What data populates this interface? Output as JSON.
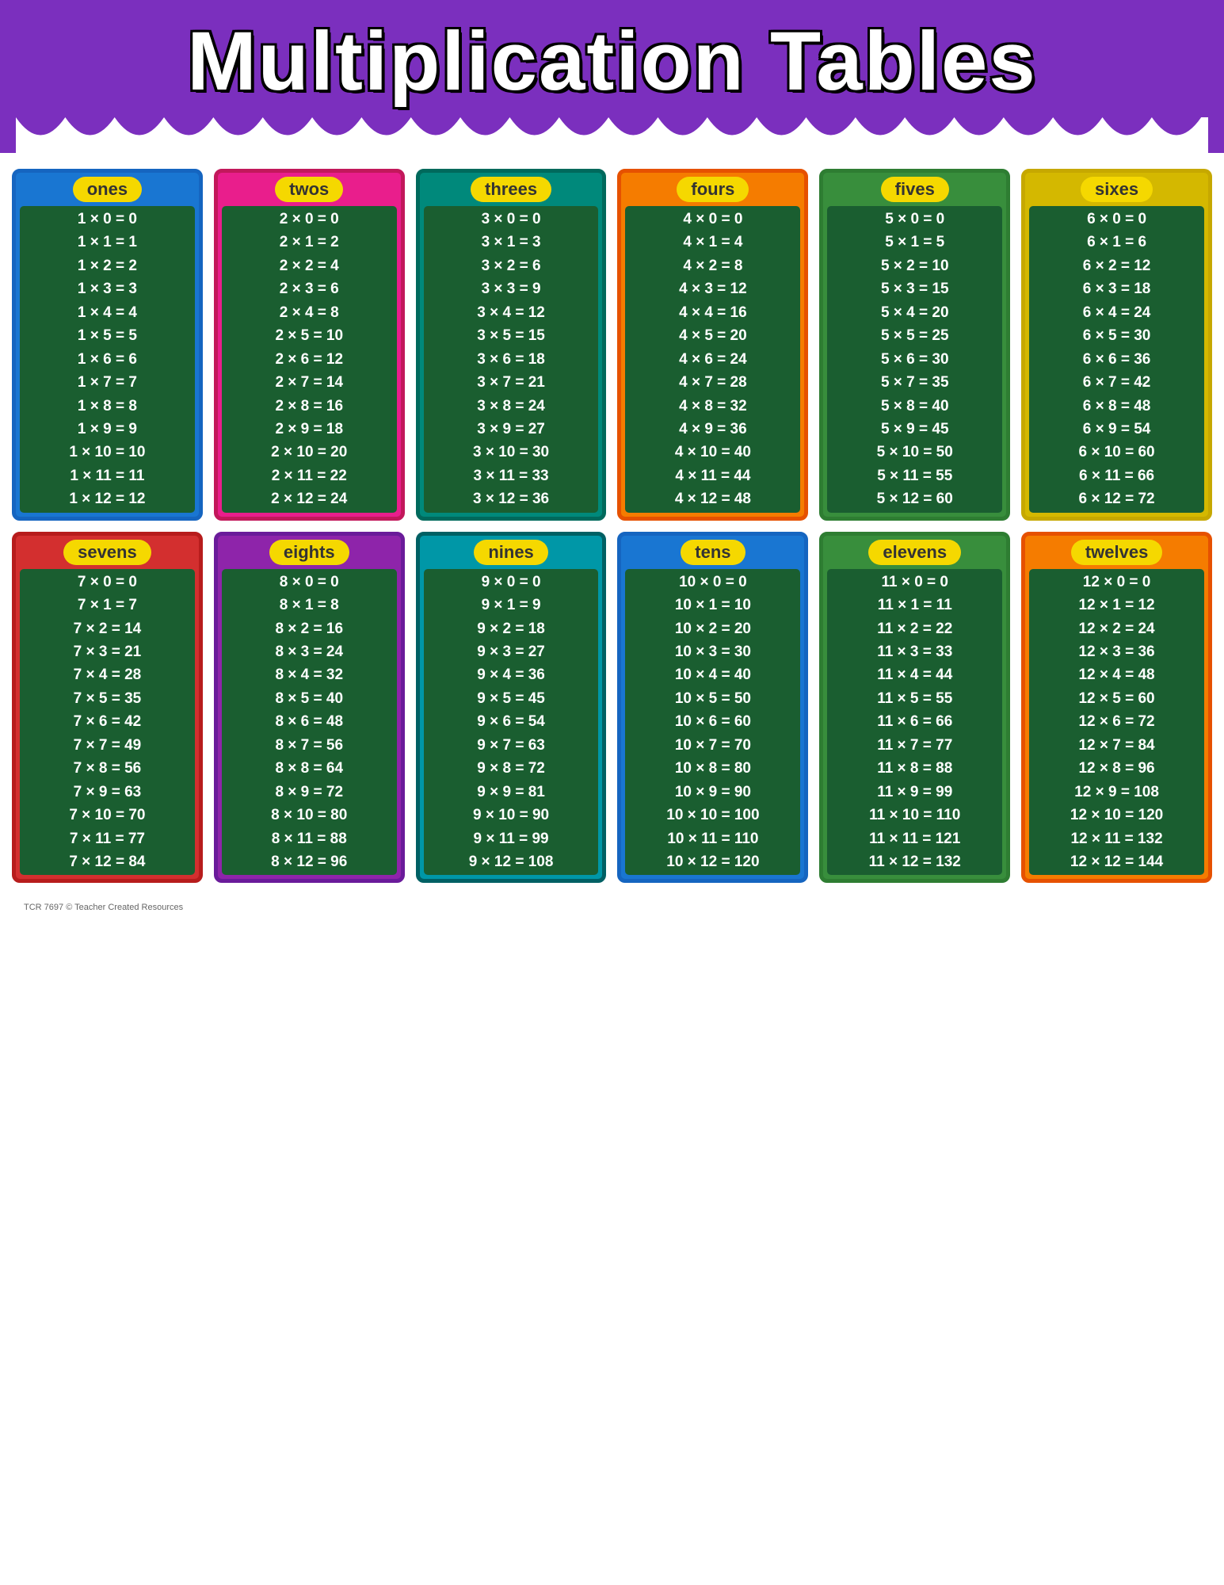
{
  "header": {
    "title": "Multiplication Tables",
    "bg_color": "#7b2fbe"
  },
  "footer": {
    "text": "TCR 7697  © Teacher Created Resources"
  },
  "tables": [
    {
      "id": "ones",
      "label": "ones",
      "color_class": "blue",
      "rows": [
        "1x0=0",
        "1x1=1",
        "1x2=2",
        "1x3=3",
        "1x4=4",
        "1x5=5",
        "1x6=6",
        "1x7=7",
        "1x8=8",
        "1x9=9",
        "1x10=10",
        "1x11=11",
        "1x12=12"
      ]
    },
    {
      "id": "twos",
      "label": "twos",
      "color_class": "pink",
      "rows": [
        "2x0=0",
        "2x1=2",
        "2x2=4",
        "2x3=6",
        "2x4=8",
        "2x5=10",
        "2x6=12",
        "2x7=14",
        "2x8=16",
        "2x9=18",
        "2x10=20",
        "2x11=22",
        "2x12=24"
      ]
    },
    {
      "id": "threes",
      "label": "threes",
      "color_class": "teal",
      "rows": [
        "3x0=0",
        "3x1=3",
        "3x2=6",
        "3x3=9",
        "3x4=12",
        "3x5=15",
        "3x6=18",
        "3x7=21",
        "3x8=24",
        "3x9=27",
        "3x10=30",
        "3x11=33",
        "3x12=36"
      ]
    },
    {
      "id": "fours",
      "label": "fours",
      "color_class": "orange",
      "rows": [
        "4x0=0",
        "4x1=4",
        "4x2=8",
        "4x3=12",
        "4x4=16",
        "4x5=20",
        "4x6=24",
        "4x7=28",
        "4x8=32",
        "4x9=36",
        "4x10=40",
        "4x11=44",
        "4x12=48"
      ]
    },
    {
      "id": "fives",
      "label": "fives",
      "color_class": "green",
      "rows": [
        "5x0=0",
        "5x1=5",
        "5x2=10",
        "5x3=15",
        "5x4=20",
        "5x5=25",
        "5x6=30",
        "5x7=35",
        "5x8=40",
        "5x9=45",
        "5x10=50",
        "5x11=55",
        "5x12=60"
      ]
    },
    {
      "id": "sixes",
      "label": "sixes",
      "color_class": "yellow-border",
      "rows": [
        "6x0=0",
        "6x1=6",
        "6x2=12",
        "6x3=18",
        "6x4=24",
        "6x5=30",
        "6x6=36",
        "6x7=42",
        "6x8=48",
        "6x9=54",
        "6x10=60",
        "6x11=66",
        "6x12=72"
      ]
    },
    {
      "id": "sevens",
      "label": "sevens",
      "color_class": "red",
      "rows": [
        "7x0=0",
        "7x1=7",
        "7x2=14",
        "7x3=21",
        "7x4=28",
        "7x5=35",
        "7x6=42",
        "7x7=49",
        "7x8=56",
        "7x9=63",
        "7x10=70",
        "7x11=77",
        "7x12=84"
      ]
    },
    {
      "id": "eights",
      "label": "eights",
      "color_class": "purple",
      "rows": [
        "8x0=0",
        "8x1=8",
        "8x2=16",
        "8x3=24",
        "8x4=32",
        "8x5=40",
        "8x6=48",
        "8x7=56",
        "8x8=64",
        "8x9=72",
        "8x10=80",
        "8x11=88",
        "8x12=96"
      ]
    },
    {
      "id": "nines",
      "label": "nines",
      "color_class": "cyan",
      "rows": [
        "9x0=0",
        "9x1=9",
        "9x2=18",
        "9x3=27",
        "9x4=36",
        "9x5=45",
        "9x6=54",
        "9x7=63",
        "9x8=72",
        "9x9=81",
        "9x10=90",
        "9x11=99",
        "9x12=108"
      ]
    },
    {
      "id": "tens",
      "label": "tens",
      "color_class": "blue",
      "rows": [
        "10x0=0",
        "10x1=10",
        "10x2=20",
        "10x3=30",
        "10x4=40",
        "10x5=50",
        "10x6=60",
        "10x7=70",
        "10x8=80",
        "10x9=90",
        "10x10=100",
        "10x11=110",
        "10x12=120"
      ]
    },
    {
      "id": "elevens",
      "label": "elevens",
      "color_class": "green",
      "rows": [
        "11x0=0",
        "11x1=11",
        "11x2=22",
        "11x3=33",
        "11x4=44",
        "11x5=55",
        "11x6=66",
        "11x7=77",
        "11x8=88",
        "11x9=99",
        "11x10=110",
        "11x11=121",
        "11x12=132"
      ]
    },
    {
      "id": "twelves",
      "label": "twelves",
      "color_class": "orange",
      "rows": [
        "12x0=0",
        "12x1=12",
        "12x2=24",
        "12x3=36",
        "12x4=48",
        "12x5=60",
        "12x6=72",
        "12x7=84",
        "12x8=96",
        "12x9=108",
        "12x10=120",
        "12x11=132",
        "12x12=144"
      ]
    }
  ]
}
